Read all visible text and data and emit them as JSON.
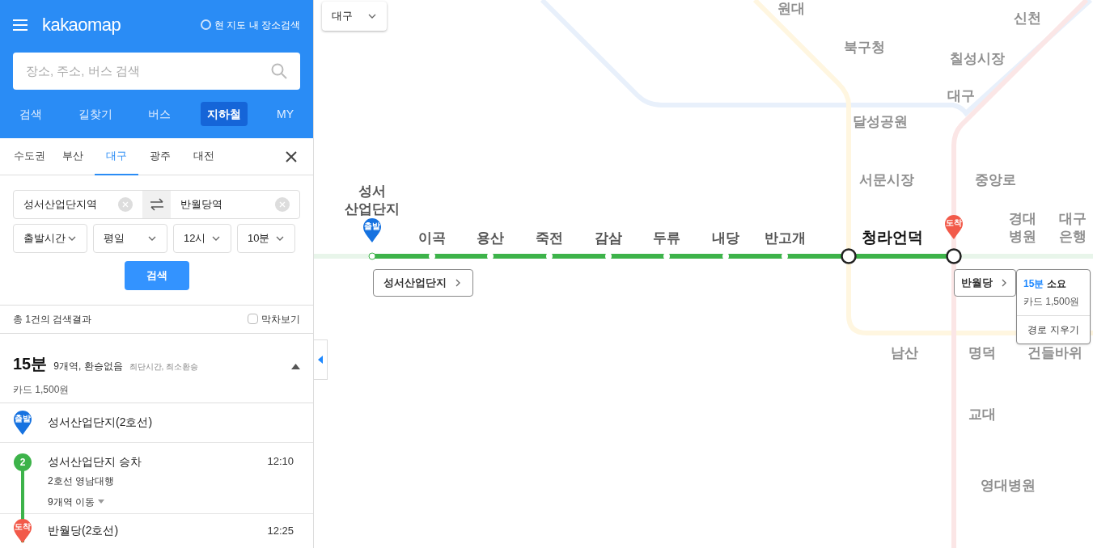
{
  "header": {
    "logo": "kakaomap",
    "area_search": {
      "label": "현 지도 내 장소검색",
      "checked": false
    },
    "search": {
      "placeholder": "장소, 주소, 버스 검색"
    }
  },
  "nav_tabs": [
    {
      "label": "검색",
      "selected": false
    },
    {
      "label": "길찾기",
      "selected": false
    },
    {
      "label": "버스",
      "selected": false
    },
    {
      "label": "지하철",
      "selected": true
    },
    {
      "label": "MY",
      "selected": false
    }
  ],
  "region_tabs": [
    {
      "label": "수도권",
      "selected": false
    },
    {
      "label": "부산",
      "selected": false
    },
    {
      "label": "대구",
      "selected": true
    },
    {
      "label": "광주",
      "selected": false
    },
    {
      "label": "대전",
      "selected": false
    }
  ],
  "route_form": {
    "from": "성서산업단지역",
    "to": "반월당역",
    "selects": [
      "출발시간",
      "평일",
      "12시",
      "10분"
    ],
    "search_button": "검색"
  },
  "results": {
    "count": "총 1건의 검색결과",
    "last_train": {
      "label": "막차보기",
      "checked": false
    }
  },
  "summary": {
    "time": "15분",
    "detail": "9개역, 환승없음",
    "tags": "최단시간, 최소환승",
    "fare": "카드 1,500원",
    "expanded": true
  },
  "steps": [
    {
      "kind": "start",
      "pin": "출발",
      "title": "성서산업단지(2호선)"
    },
    {
      "kind": "ride",
      "line": "2",
      "title": "성서산업단지 승차",
      "time": "12:10",
      "direction": "2호선 영남대행",
      "stops": "9개역 이동"
    },
    {
      "kind": "end",
      "pin": "도착",
      "title": "반월당(2호선)",
      "time": "12:25"
    }
  ],
  "map": {
    "city_select": "대구",
    "route_stations": [
      {
        "kind": "start",
        "lines": [
          "성서",
          "산업단지"
        ]
      },
      {
        "kind": "stop",
        "lines": [
          "이곡"
        ]
      },
      {
        "kind": "stop",
        "lines": [
          "용산"
        ]
      },
      {
        "kind": "stop",
        "lines": [
          "죽전"
        ]
      },
      {
        "kind": "stop",
        "lines": [
          "감삼"
        ]
      },
      {
        "kind": "stop",
        "lines": [
          "두류"
        ]
      },
      {
        "kind": "stop",
        "lines": [
          "내당"
        ]
      },
      {
        "kind": "stop",
        "lines": [
          "반고개"
        ]
      },
      {
        "kind": "transfer",
        "lines": [
          "청라언덕"
        ]
      },
      {
        "kind": "end"
      }
    ],
    "start_pin": "출발",
    "end_pin": "도착",
    "start_callout": "성서산업단지",
    "end_callout": "반월당",
    "info": {
      "time": "15분",
      "label": "소요",
      "fare": "카드 1,500원",
      "clear": "경로 지우기"
    },
    "other_labels": [
      "원대",
      "북구청",
      "칠성시장",
      "신천",
      "대구",
      "달성공원",
      "서문시장",
      "중앙로",
      "경대\n병원",
      "대구\n은행",
      "남산",
      "명덕",
      "건들바위",
      "교대",
      "영대병원"
    ]
  }
}
